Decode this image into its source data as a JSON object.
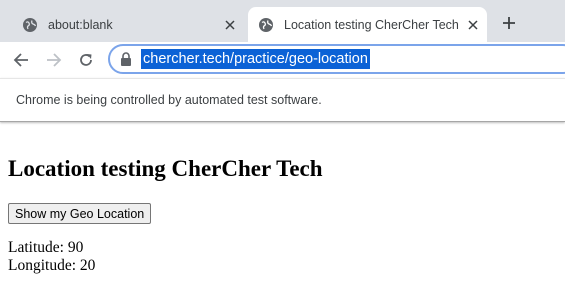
{
  "browser": {
    "tabs": [
      {
        "title": "about:blank",
        "active": false
      },
      {
        "title": "Location testing CherCher Tech",
        "active": true
      }
    ],
    "address_bar": {
      "url": "chercher.tech/practice/geo-location"
    },
    "infobar_message": "Chrome is being controlled by automated test software."
  },
  "page": {
    "heading": "Location testing CherCher Tech",
    "button_label": "Show my Geo Location",
    "latitude_label": "Latitude:",
    "latitude_value": "90",
    "longitude_label": "Longitude:",
    "longitude_value": "20"
  },
  "colors": {
    "tabstrip_bg": "#dee1e6",
    "url_highlight": "#0b62d6",
    "omnibox_border": "#7ba4ea"
  },
  "icons": [
    "globe-icon",
    "close-icon",
    "plus-icon",
    "back-icon",
    "forward-icon",
    "reload-icon",
    "lock-icon"
  ]
}
